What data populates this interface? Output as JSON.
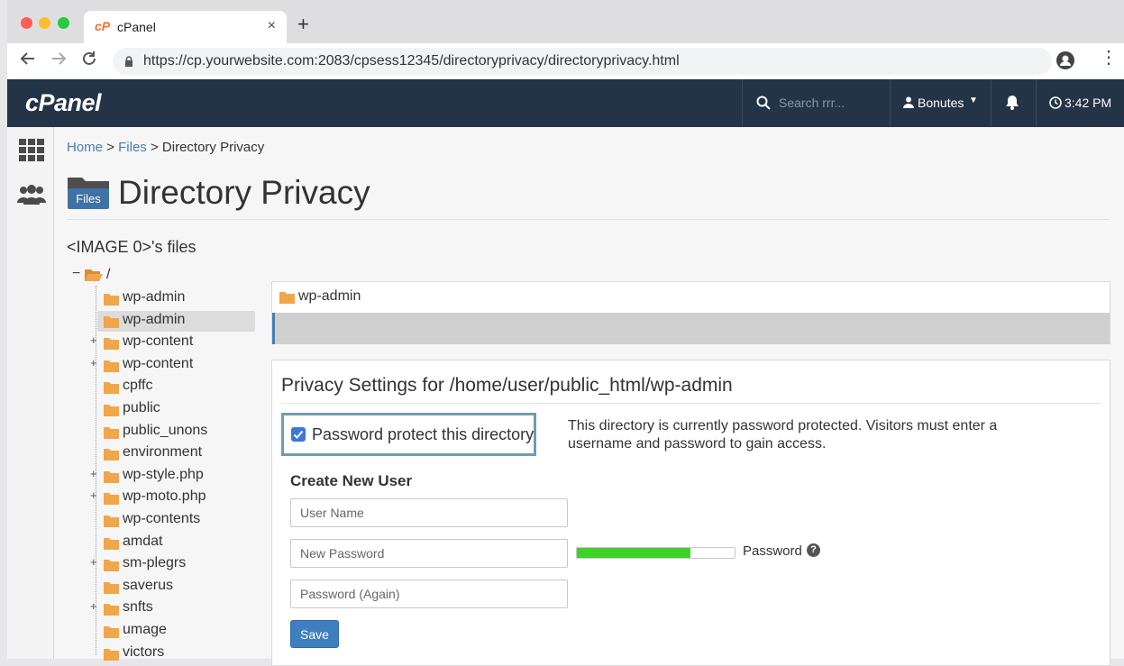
{
  "browser": {
    "tab_logo": "cP",
    "tab_title": "cPanel",
    "tab_close": "×",
    "new_tab": "+",
    "url": "https://cp.yourwebsite.com:2083/cpsess12345/directoryprivacy/directoryprivacy.html"
  },
  "header": {
    "logo": "cPanel",
    "search_placeholder": "Search rrr...",
    "user": "Bonutes",
    "time": "3:42 PM"
  },
  "breadcrumb": {
    "home": "Home",
    "sep1": ">",
    "files": "Files",
    "sep2": ">",
    "current": "Directory Privacy"
  },
  "page": {
    "files_badge": "Files",
    "title": "Directory Privacy",
    "tree_heading": "<IMAGE 0>'s files"
  },
  "tree": {
    "root_label": "/",
    "items": [
      {
        "label": "wp-admin",
        "expander": ""
      },
      {
        "label": "wp-admin",
        "expander": "",
        "selected": true
      },
      {
        "label": "wp-content",
        "expander": "+"
      },
      {
        "label": "wp-content",
        "expander": "+"
      },
      {
        "label": "cpffc",
        "expander": ""
      },
      {
        "label": "public",
        "expander": ""
      },
      {
        "label": "public_unons",
        "expander": ""
      },
      {
        "label": "environment",
        "expander": ""
      },
      {
        "label": "wp-style.php",
        "expander": "+"
      },
      {
        "label": "wp-moto.php",
        "expander": "+"
      },
      {
        "label": "wp-contents",
        "expander": ""
      },
      {
        "label": "amdat",
        "expander": ""
      },
      {
        "label": "sm-plegrs",
        "expander": "+"
      },
      {
        "label": "saverus",
        "expander": ""
      },
      {
        "label": "snfts",
        "expander": "+"
      },
      {
        "label": "umage",
        "expander": ""
      },
      {
        "label": "victors",
        "expander": ""
      }
    ]
  },
  "selected_dir": {
    "label": "wp-admin"
  },
  "privacy": {
    "title": "Privacy Settings for /home/user/public_html/wp-admin",
    "protect_label": "Password protect this directory",
    "protect_checked": true,
    "status_text": "This directory is currently password protected. Visitors must enter a username and password to gain access.",
    "create_user_heading": "Create New User",
    "username_placeholder": "User Name",
    "password_placeholder": "New Password",
    "password_again_placeholder": "Password (Again)",
    "strength_fraction": 0.72,
    "strength_label": "Password",
    "help_glyph": "?",
    "save_label": "Save"
  },
  "colors": {
    "header_bg": "#233447",
    "accent_blue": "#3f7fbf",
    "strength_green": "#42d12a",
    "folder_orange": "#f0a64a"
  }
}
